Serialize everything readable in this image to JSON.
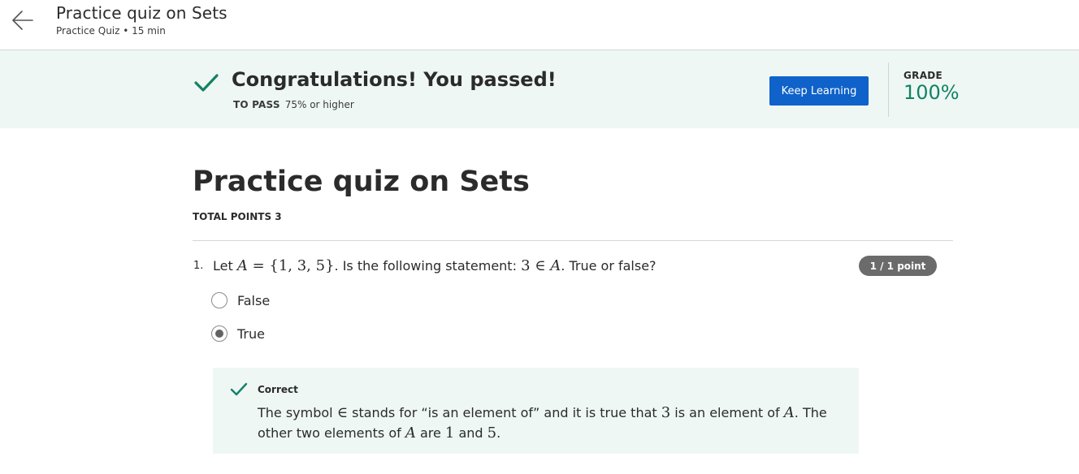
{
  "header": {
    "title": "Practice quiz on Sets",
    "subtitle": "Practice Quiz • 15 min",
    "back_icon": "arrow-left-icon"
  },
  "banner": {
    "title": "Congratulations! You passed!",
    "pass_label": "TO PASS",
    "pass_value": "75% or higher",
    "button_label": "Keep Learning",
    "grade_label": "GRADE",
    "grade_value": "100%",
    "check_icon": "check-icon",
    "colors": {
      "accent": "#128264",
      "button": "#0f62c9",
      "background": "#eef7f4"
    }
  },
  "quiz": {
    "title": "Practice quiz on Sets",
    "total_points": "TOTAL POINTS 3"
  },
  "question": {
    "number": "1.",
    "text_parts": {
      "p1": "Let ",
      "set_name": "A",
      "eq": " = ",
      "set_value": "{1, 3, 5}",
      "p2": ". Is the following statement: ",
      "element": "3",
      "member_symbol": " ∈ ",
      "set_ref": "A",
      "p3": ". True or false?"
    },
    "points": "1 / 1 point",
    "options": [
      {
        "label": "False",
        "selected": false
      },
      {
        "label": "True",
        "selected": true
      }
    ]
  },
  "feedback": {
    "title": "Correct",
    "parts": {
      "p1": "The symbol ",
      "sym": "∈",
      "p2": " stands for “is an element of” and it is true that ",
      "three": "3",
      "p3": " is an element of ",
      "a1": "A",
      "p4": ". The other two elements of ",
      "a2": "A",
      "p5": " are ",
      "one": "1",
      "p6": " and ",
      "five": "5",
      "p7": "."
    }
  }
}
